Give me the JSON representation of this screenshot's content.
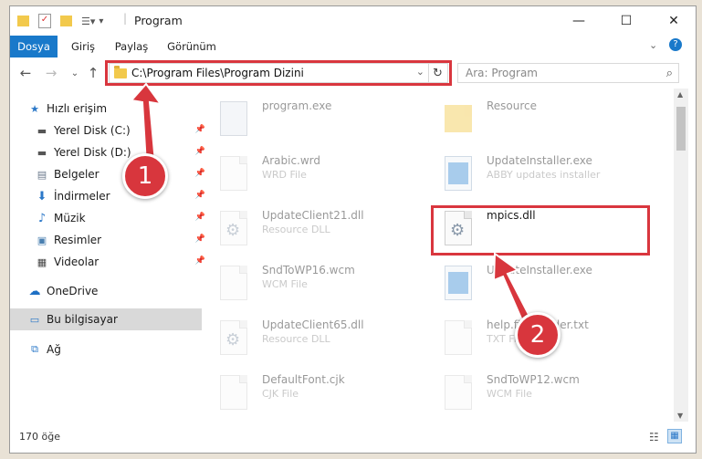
{
  "window": {
    "title": "Program"
  },
  "ribbon": {
    "tabs": [
      "Dosya",
      "Giriş",
      "Paylaş",
      "Görünüm"
    ]
  },
  "address": {
    "path": "C:\\Program Files\\Program Dizini",
    "search_placeholder": "Ara: Program"
  },
  "sidebar": {
    "quick_access": "Hızlı erişim",
    "items": [
      {
        "label": "Yerel Disk (C:)"
      },
      {
        "label": "Yerel Disk (D:)"
      },
      {
        "label": "Belgeler"
      },
      {
        "label": "İndirmeler"
      },
      {
        "label": "Müzik"
      },
      {
        "label": "Resimler"
      },
      {
        "label": "Videolar"
      }
    ],
    "onedrive": "OneDrive",
    "this_pc": "Bu bilgisayar",
    "network": "Ağ"
  },
  "files": [
    {
      "name": "program.exe",
      "type": ""
    },
    {
      "name": "Resource",
      "type": ""
    },
    {
      "name": "Arabic.wrd",
      "type": "WRD File"
    },
    {
      "name": "UpdateInstaller.exe",
      "type": "ABBY updates installer"
    },
    {
      "name": "UpdateClient21.dll",
      "type": "Resource DLL"
    },
    {
      "name": "mpics.dll",
      "type": ""
    },
    {
      "name": "SndToWP16.wcm",
      "type": "WCM File"
    },
    {
      "name": "UpdateInstaller.exe",
      "type": ""
    },
    {
      "name": "UpdateClient65.dll",
      "type": "Resource DLL"
    },
    {
      "name": "help.firstreader.txt",
      "type": "TXT File"
    },
    {
      "name": "DefaultFont.cjk",
      "type": "CJK File"
    },
    {
      "name": "SndToWP12.wcm",
      "type": "WCM File"
    }
  ],
  "status": {
    "count": "170 öğe"
  },
  "callouts": [
    "1",
    "2"
  ]
}
